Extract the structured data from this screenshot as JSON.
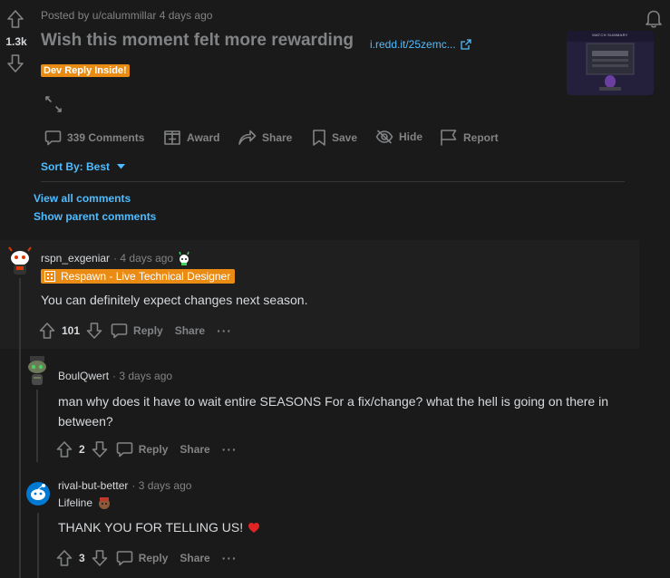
{
  "post": {
    "author_line": "Posted by u/calummillar 4 days ago",
    "votes": "1.3k",
    "title": "Wish this moment felt more rewarding",
    "link": "i.redd.it/25zemc...",
    "flair": "Dev Reply Inside!",
    "thumbnail_text": "MATCH SUMMARY",
    "actions": {
      "comments": "339 Comments",
      "award": "Award",
      "share": "Share",
      "save": "Save",
      "hide": "Hide",
      "report": "Report"
    },
    "sort_label": "Sort By: Best",
    "view_all": "View all comments",
    "show_parent": "Show parent comments"
  },
  "comments": [
    {
      "author": "rspn_exgeniar",
      "time": "· 4 days ago",
      "flair": "Respawn - Live Technical Designer",
      "body": "You can definitely expect changes next season.",
      "votes": "101",
      "reply": "Reply",
      "share": "Share",
      "more": "···"
    },
    {
      "author": "BoulQwert",
      "time": "· 3 days ago",
      "body": "man why does it have to wait entire SEASONS For a fix/change? what the hell is going on there in between?",
      "votes": "2",
      "reply": "Reply",
      "share": "Share",
      "more": "···"
    },
    {
      "author": "rival-but-better",
      "time": "· 3 days ago",
      "flair": "Lifeline",
      "body": "THANK YOU FOR TELLING US!",
      "votes": "3",
      "reply": "Reply",
      "share": "Share",
      "more": "···"
    }
  ],
  "colors": {
    "background": "#1a1a1b",
    "accent_blue": "#4fbcff",
    "flair_orange": "#ea8b14",
    "muted": "#818384"
  }
}
